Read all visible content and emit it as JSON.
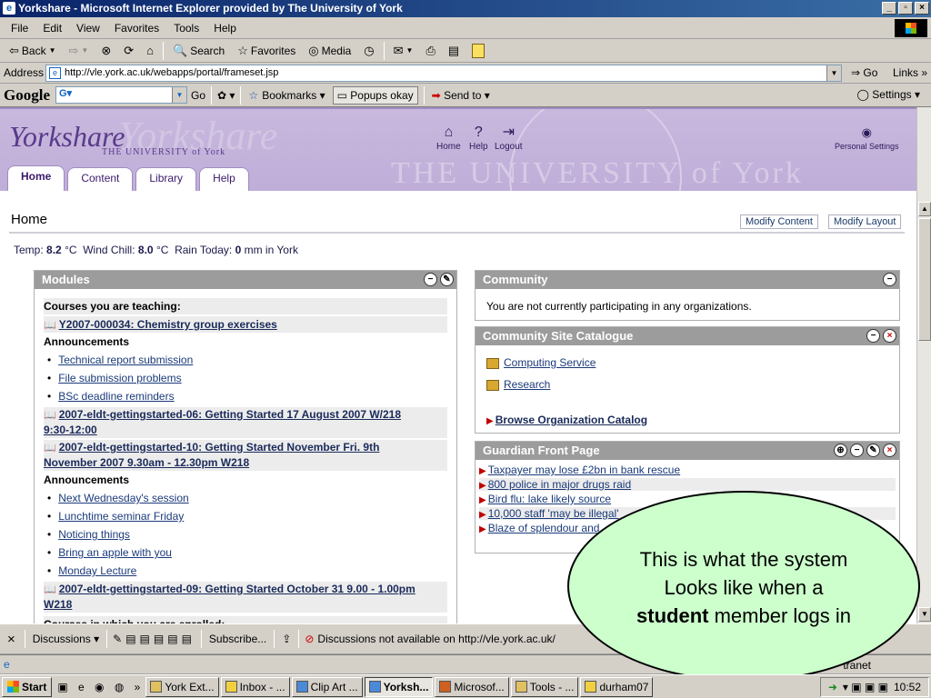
{
  "window": {
    "title": "Yorkshare - Microsoft Internet Explorer provided by The University of York"
  },
  "menu": [
    "File",
    "Edit",
    "View",
    "Favorites",
    "Tools",
    "Help"
  ],
  "toolbar": {
    "back": "Back",
    "search": "Search",
    "favorites": "Favorites",
    "media": "Media"
  },
  "address": {
    "label": "Address",
    "url": "http://vle.york.ac.uk/webapps/portal/frameset.jsp",
    "go": "Go",
    "links": "Links"
  },
  "googlebar": {
    "logo": "Google",
    "go": "Go",
    "bookmarks": "Bookmarks",
    "popups": "Popups okay",
    "sendto": "Send to",
    "settings": "Settings"
  },
  "site": {
    "logo": "Yorkshare",
    "logo_sub": "THE UNIVERSITY of York",
    "watermark": "THE UNIVERSITY of York",
    "nav": [
      "Home",
      "Help",
      "Logout"
    ],
    "personal": "Personal Settings",
    "tabs": [
      "Home",
      "Content",
      "Library",
      "Help"
    ]
  },
  "home": {
    "title": "Home",
    "modify_content": "Modify Content",
    "modify_layout": "Modify Layout"
  },
  "weather": {
    "temp_label": "Temp:",
    "temp": "8.2",
    "unit": "°C",
    "chill_label": "Wind Chill:",
    "chill": "8.0",
    "rain_label": "Rain Today:",
    "rain": "0",
    "rain_unit": "mm in York"
  },
  "modules": {
    "title": "Modules",
    "teaching_label": "Courses you are teaching:",
    "course1": "Y2007-000034: Chemistry group exercises",
    "announcements": "Announcements",
    "ann1": [
      "Technical report submission",
      "File submission problems",
      "BSc deadline reminders"
    ],
    "course2_a": "2007-eldt-gettingstarted-06: Getting Started 17 August 2007 W/218",
    "course2_b": "9:30-12:00",
    "course3_a": "2007-eldt-gettingstarted-10: Getting Started November Fri. 9th",
    "course3_b": "November 2007 9.30am - 12.30pm W218",
    "ann2": [
      "Next Wednesday's session",
      "Lunchtime seminar Friday",
      "Noticing things",
      "Bring an apple with you",
      "Monday Lecture"
    ],
    "course4_a": "2007-eldt-gettingstarted-09: Getting Started October 31 9.00 - 1.00pm",
    "course4_b": "W218",
    "enrolled": "Courses in which you are enrolled:"
  },
  "community": {
    "title": "Community",
    "text": "You are not currently participating in any organizations."
  },
  "catalogue": {
    "title": "Community Site Catalogue",
    "items": [
      "Computing Service",
      "Research"
    ],
    "browse": "Browse Organization Catalog"
  },
  "guardian": {
    "title": "Guardian Front Page",
    "items": [
      "Taxpayer may lose £2bn in bank rescue",
      "800 police in major drugs raid",
      "Bird flu: lake likely source",
      "10,000 staff 'may be illegal'",
      "Blaze of splendour and"
    ]
  },
  "callout": {
    "line1": "This is what the system",
    "line2": "Looks like when a",
    "bold": "student",
    "line3": " member logs in"
  },
  "discussions": {
    "label": "Discussions",
    "subscribe": "Subscribe...",
    "notice": "Discussions not available on http://vle.york.ac.uk/"
  },
  "status": {
    "zone": "tranet"
  },
  "taskbar": {
    "start": "Start",
    "tasks": [
      "York Ext...",
      "Inbox - ...",
      "Clip Art ...",
      "Yorksh...",
      "Microsof...",
      "Tools - ...",
      "durham07"
    ],
    "clock": "10:52"
  }
}
